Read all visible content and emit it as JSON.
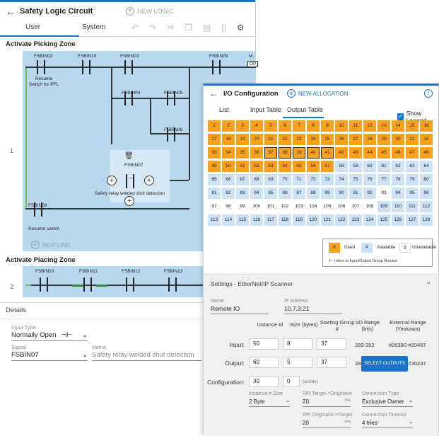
{
  "logic": {
    "title": "Safety Logic Circuit",
    "new_logic": "NEW LOGIC",
    "tabs": [
      "User",
      "System"
    ],
    "zone1": "Activate Picking Zone",
    "zone2": "Activate Placing Zone",
    "row1": "1",
    "row2": "2",
    "ladder1_labels": [
      "FSBIN02",
      "FSBIN10",
      "FSBIN03",
      "FSBIN09",
      "M",
      "OP",
      "FSBIN04",
      "FSBIN05",
      "FSBIN06",
      "FSBIN07",
      "FSBIN08"
    ],
    "resume_pfl": "Resume Switch for PFL",
    "safety_relay": "Safety relay welded shut detection",
    "resume_switch": "Resume switch",
    "new_line": "NEW LINE",
    "ladder2_labels": [
      "FSBIN10",
      "FSBIN11",
      "FSBIN12",
      "FSBIN13"
    ],
    "details": {
      "title": "Details",
      "input_type_label": "Input Type",
      "input_type_value": "Normally Open",
      "signal_label": "Signal",
      "signal_value": "FSBIN07",
      "name_label": "Name",
      "name_value": "Safety relay welded shut detection"
    }
  },
  "io": {
    "title": "I/O Configuration",
    "new_allocation": "NEW ALLOCATION",
    "info_icon": "i",
    "tabs": [
      "List",
      "Input Table",
      "Output Table"
    ],
    "show_legend": "Show Legend",
    "grid": {
      "used": [
        1,
        2,
        3,
        4,
        5,
        6,
        7,
        8,
        9,
        10,
        11,
        12,
        13,
        14,
        15,
        16,
        17,
        18,
        19,
        20,
        21,
        22,
        23,
        24,
        25,
        26,
        27,
        28,
        29,
        30,
        31,
        32,
        33,
        34,
        35,
        36,
        37,
        38,
        39,
        40,
        41,
        42,
        43,
        44,
        45,
        46,
        47,
        48,
        49,
        50,
        51,
        52,
        53,
        54,
        55,
        56,
        57
      ],
      "unavailable": [
        93,
        97,
        98,
        99,
        100,
        101,
        102,
        103,
        104,
        105,
        106,
        107,
        108
      ],
      "selected": [
        37,
        38,
        39,
        40,
        41
      ]
    },
    "legend": {
      "used_sym": "#",
      "used": "Used",
      "available_sym": "#",
      "available": "Available",
      "unavailable_sym": "#",
      "unavailable": "Unavailable",
      "note": "# - refers to Input/Output Group Number"
    },
    "colors": {
      "used": "#f9a11b",
      "available": "#cde2f6",
      "accent": "#1a73c9"
    },
    "settings": {
      "title": "Settings - EtherNet/IP Scanner",
      "name_label": "Name",
      "name_value": "Remote IO",
      "ip_label": "IP Address",
      "ip_value": "10.7.3.21",
      "col_instance": "Instance Id",
      "col_size": "Size (bytes)",
      "col_start": "Starting Group #",
      "col_range": "I/O Range (bits)",
      "col_ext": "External Range (Yaskawa)",
      "input_label": "Input:",
      "input_instance": "50",
      "input_size": "8",
      "input_start": "37",
      "input_range": "289-352",
      "input_ext": "#20390-#20467",
      "output_label": "Output:",
      "output_instance": "60",
      "output_size": "5",
      "output_start": "37",
      "output_range": "289-328",
      "output_ext": "#30390-#30437",
      "config_label": "Configuration:",
      "config_instance": "30",
      "config_size": "0",
      "config_unit": "(words)",
      "select_outputs": "SELECT OUTPUTS",
      "inst_size_label": "Instance # Size",
      "inst_size_value": "2 Byte",
      "rpi_t2o_label": "RPI Target->Originator",
      "rpi_t2o_value": "20",
      "rpi_o2t_label": "RPI Originator->Target",
      "rpi_o2t_value": "20",
      "ms": "ms",
      "conn_type_label": "Connection Type",
      "conn_type_value": "Exclusive Owner",
      "conn_timeout_label": "Connection Timeout",
      "conn_timeout_value": "4 tries"
    }
  }
}
